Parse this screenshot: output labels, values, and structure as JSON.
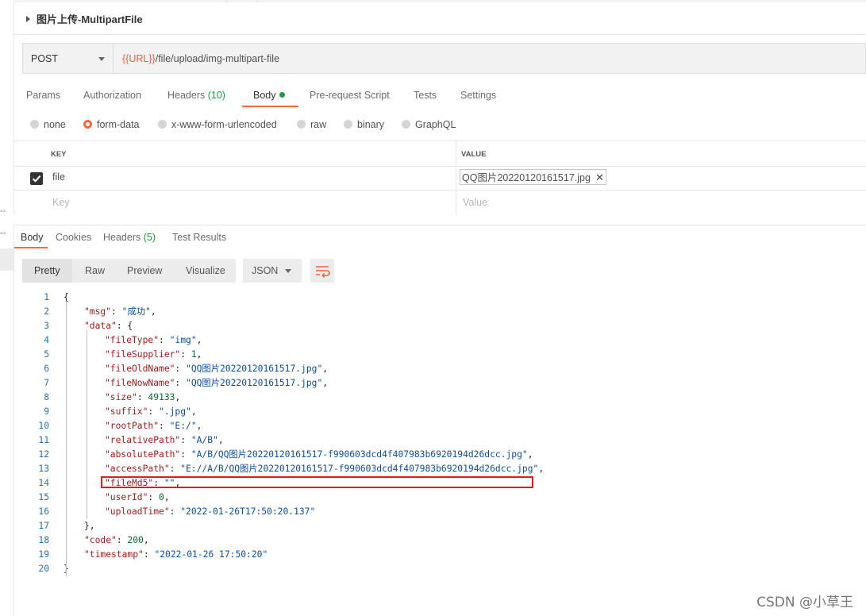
{
  "request": {
    "name": "图片上传-MultipartFile",
    "method": "POST",
    "url_var": "{{URL}}",
    "url_path": "/file/upload/img-multipart-file"
  },
  "request_tabs": {
    "params": "Params",
    "authorization": "Authorization",
    "headers": "Headers",
    "headers_count": "(10)",
    "body": "Body",
    "prerequest": "Pre-request Script",
    "tests": "Tests",
    "settings": "Settings"
  },
  "body_modes": [
    "none",
    "form-data",
    "x-www-form-urlencoded",
    "raw",
    "binary",
    "GraphQL"
  ],
  "body_mode_selected": "form-data",
  "form": {
    "key_header": "KEY",
    "value_header": "VALUE",
    "rows": [
      {
        "checked": true,
        "key": "file",
        "value": "QQ图片20220120161517.jpg"
      }
    ],
    "key_placeholder": "Key",
    "value_placeholder": "Value"
  },
  "response_tabs": {
    "body": "Body",
    "cookies": "Cookies",
    "headers": "Headers",
    "headers_count": "(5)",
    "test_results": "Test Results"
  },
  "view_modes": [
    "Pretty",
    "Raw",
    "Preview",
    "Visualize"
  ],
  "view_mode_selected": "Pretty",
  "format": "JSON",
  "response_lines": [
    [
      [
        "p",
        "{"
      ]
    ],
    [
      [
        "k",
        "\"msg\""
      ],
      [
        "p",
        ": "
      ],
      [
        "s",
        "\"成功\""
      ],
      [
        "p",
        ","
      ]
    ],
    [
      [
        "k",
        "\"data\""
      ],
      [
        "p",
        ": {"
      ]
    ],
    [
      [
        "k",
        "\"fileType\""
      ],
      [
        "p",
        ": "
      ],
      [
        "s",
        "\"img\""
      ],
      [
        "p",
        ","
      ]
    ],
    [
      [
        "k",
        "\"fileSupplier\""
      ],
      [
        "p",
        ": "
      ],
      [
        "n",
        "1"
      ],
      [
        "p",
        ","
      ]
    ],
    [
      [
        "k",
        "\"fileOldName\""
      ],
      [
        "p",
        ": "
      ],
      [
        "s",
        "\"QQ图片20220120161517.jpg\""
      ],
      [
        "p",
        ","
      ]
    ],
    [
      [
        "k",
        "\"fileNowName\""
      ],
      [
        "p",
        ": "
      ],
      [
        "s",
        "\"QQ图片20220120161517.jpg\""
      ],
      [
        "p",
        ","
      ]
    ],
    [
      [
        "k",
        "\"size\""
      ],
      [
        "p",
        ": "
      ],
      [
        "n",
        "49133"
      ],
      [
        "p",
        ","
      ]
    ],
    [
      [
        "k",
        "\"suffix\""
      ],
      [
        "p",
        ": "
      ],
      [
        "s",
        "\".jpg\""
      ],
      [
        "p",
        ","
      ]
    ],
    [
      [
        "k",
        "\"rootPath\""
      ],
      [
        "p",
        ": "
      ],
      [
        "s",
        "\"E:/\""
      ],
      [
        "p",
        ","
      ]
    ],
    [
      [
        "k",
        "\"relativePath\""
      ],
      [
        "p",
        ": "
      ],
      [
        "s",
        "\"A/B\""
      ],
      [
        "p",
        ","
      ]
    ],
    [
      [
        "k",
        "\"absolutePath\""
      ],
      [
        "p",
        ": "
      ],
      [
        "s",
        "\"A/B/QQ图片20220120161517-f990603dcd4f407983b6920194d26dcc.jpg\""
      ],
      [
        "p",
        ","
      ]
    ],
    [
      [
        "k",
        "\"accessPath\""
      ],
      [
        "p",
        ": "
      ],
      [
        "s",
        "\"E://A/B/QQ图片20220120161517-f990603dcd4f407983b6920194d26dcc.jpg\""
      ],
      [
        "p",
        ","
      ]
    ],
    [
      [
        "k",
        "\"fileMd5\""
      ],
      [
        "p",
        ": "
      ],
      [
        "s",
        "\"\""
      ],
      [
        "p",
        ","
      ]
    ],
    [
      [
        "k",
        "\"userId\""
      ],
      [
        "p",
        ": "
      ],
      [
        "n",
        "0"
      ],
      [
        "p",
        ","
      ]
    ],
    [
      [
        "k",
        "\"uploadTime\""
      ],
      [
        "p",
        ": "
      ],
      [
        "s",
        "\"2022-01-26T17:50:20.137\""
      ]
    ],
    [
      [
        "p",
        "},"
      ]
    ],
    [
      [
        "k",
        "\"code\""
      ],
      [
        "p",
        ": "
      ],
      [
        "n",
        "200"
      ],
      [
        "p",
        ","
      ]
    ],
    [
      [
        "k",
        "\"timestamp\""
      ],
      [
        "p",
        ": "
      ],
      [
        "s",
        "\"2022-01-26 17:50:20\""
      ]
    ],
    [
      [
        "p",
        "}"
      ]
    ]
  ],
  "highlighted_line": 14,
  "watermark": "CSDN @小草王",
  "colors": {
    "accent": "#f26b3a",
    "success": "#1a9c3e",
    "highlight_box": "#e01c1c"
  }
}
